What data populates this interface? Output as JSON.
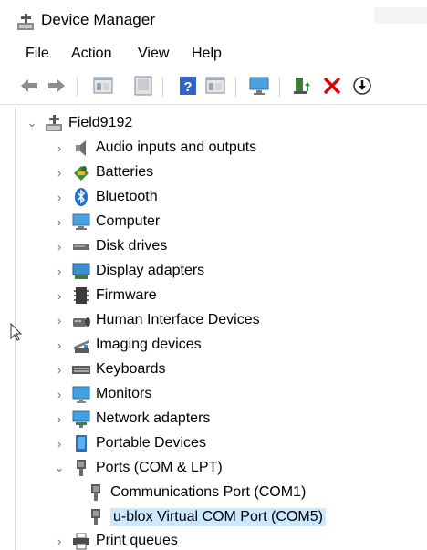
{
  "window": {
    "title": "Device Manager"
  },
  "menu": [
    "File",
    "Action",
    "View",
    "Help"
  ],
  "toolbar": {
    "buttons": [
      "back-icon",
      "forward-icon",
      "properties-window-icon",
      "update-view-icon",
      "help-icon",
      "show-hidden-icon",
      "monitor-scan-icon",
      "add-driver-icon",
      "uninstall-icon",
      "download-icon"
    ]
  },
  "tree": {
    "root": "Field9192",
    "categories": [
      "Audio inputs and outputs",
      "Batteries",
      "Bluetooth",
      "Computer",
      "Disk drives",
      "Display adapters",
      "Firmware",
      "Human Interface Devices",
      "Imaging devices",
      "Keyboards",
      "Monitors",
      "Network adapters",
      "Portable Devices",
      "Ports (COM & LPT)",
      "Communications Port (COM1)",
      "u-blox Virtual COM Port (COM5)",
      "Print queues"
    ]
  },
  "colors": {
    "selection": "#cce8ff",
    "accent_red": "#e00000",
    "accent_blue": "#1e6fd0"
  }
}
